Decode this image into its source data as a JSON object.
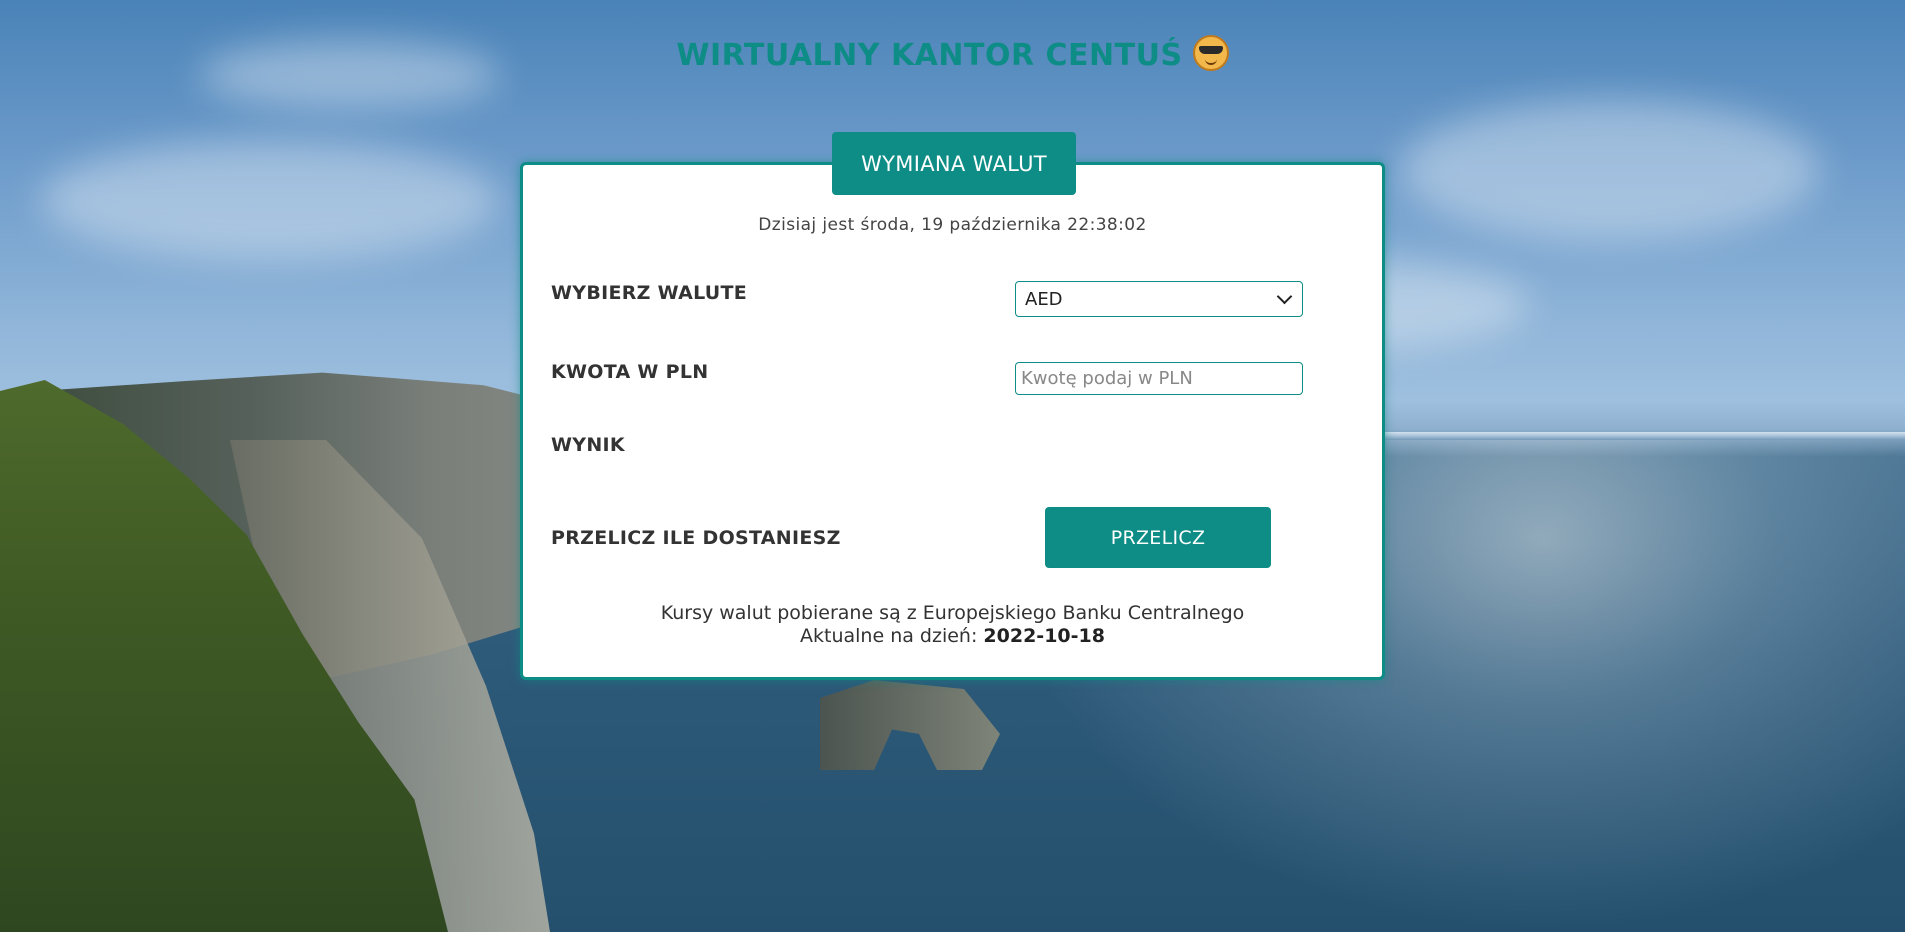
{
  "header": {
    "title": "WIRTUALNY KANTOR CENTUŚ",
    "emoji_icon": "smiling-face-with-sunglasses-icon"
  },
  "card": {
    "tab_label": "WYMIANA WALUT",
    "date_text": "Dzisiaj jest środa, 19 października 22:38:02",
    "currency_label": "WYBIERZ WALUTE",
    "currency_selected": "AED",
    "amount_label": "KWOTA W PLN",
    "amount_placeholder": "Kwotę podaj w PLN",
    "amount_value": "",
    "result_label": "WYNIK",
    "result_value": "",
    "convert_label": "PRZELICZ ILE DOSTANIESZ",
    "convert_button": "PRZELICZ",
    "footer_line1": "Kursy walut pobierane są z Europejskiego Banku Centralnego",
    "footer_line2_prefix": "Aktualne na dzień:",
    "footer_date": "2022-10-18"
  },
  "colors": {
    "accent": "#0e8c86",
    "card_bg": "#ffffff"
  }
}
